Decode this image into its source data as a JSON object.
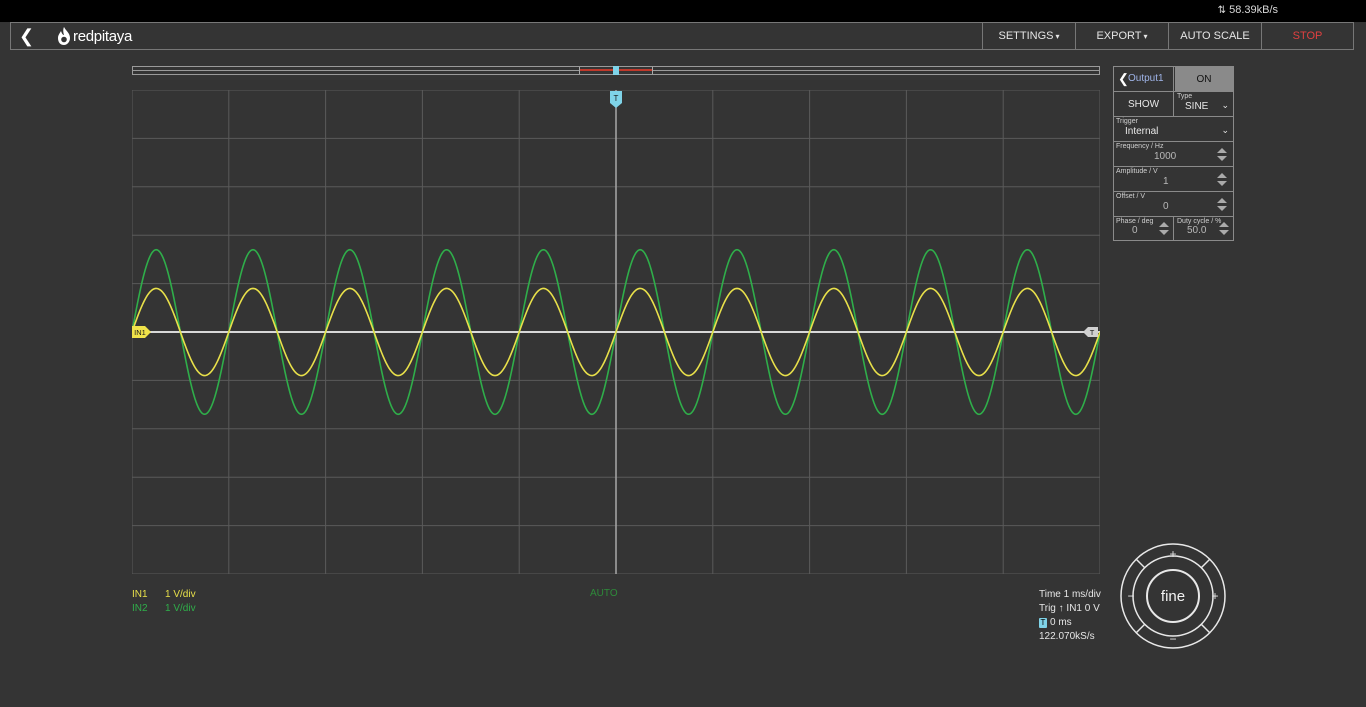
{
  "status": {
    "transfer_rate": "58.39kB/s"
  },
  "navbar": {
    "brand": "redpitaya",
    "settings_label": "SETTINGS",
    "export_label": "EXPORT",
    "autoscale_label": "AUTO SCALE",
    "stop_label": "STOP"
  },
  "colors": {
    "in1": "#e8e04a",
    "in2": "#2fae4a",
    "trigger": "#7fd3e8",
    "stop": "#e04040"
  },
  "markers": {
    "trigger_time": "T",
    "in1_offset": "IN1",
    "trigger_level": "T"
  },
  "channels": [
    {
      "name": "IN1",
      "scale": "1 V/div"
    },
    {
      "name": "IN2",
      "scale": "1 V/div"
    }
  ],
  "trigger_mode": "AUTO",
  "acquisition": {
    "time_scale": "Time 1 ms/div",
    "trig_prefix": "Trig",
    "trig_value": "IN1 0 V",
    "position_icon": "T",
    "position": "0 ms",
    "sample_rate": "122.070kS/s"
  },
  "output_panel": {
    "title": "Output1",
    "state_label": "ON",
    "show_label": "SHOW",
    "type_label": "Type",
    "type_value": "SINE",
    "trigger_label": "Trigger",
    "trigger_value": "Internal",
    "frequency_label": "Frequency / Hz",
    "frequency_value": "1000",
    "amplitude_label": "Amplitude / V",
    "amplitude_value": "1",
    "offset_label": "Offset / V",
    "offset_value": "0",
    "phase_label": "Phase / deg",
    "phase_value": "0",
    "duty_label": "Duty cycle / %",
    "duty_value": "50.0"
  },
  "controller": {
    "center_label": "fine",
    "up": "+",
    "down": "−",
    "left": "−",
    "right": "+"
  },
  "chart_data": {
    "type": "line",
    "xlabel": "",
    "ylabel": "",
    "grid": true,
    "divisions": {
      "x": 10,
      "y": 10
    },
    "x_unit_per_div": "1 ms",
    "y_unit_per_div": "1 V",
    "series": [
      {
        "name": "IN1",
        "waveform": "sine",
        "frequency_hz": 1000,
        "amplitude_v": 0.9,
        "offset_v": 0,
        "phase_deg": 0
      },
      {
        "name": "IN2",
        "waveform": "sine",
        "frequency_hz": 1000,
        "amplitude_v": 1.7,
        "offset_v": 0,
        "phase_deg": 0
      }
    ]
  }
}
